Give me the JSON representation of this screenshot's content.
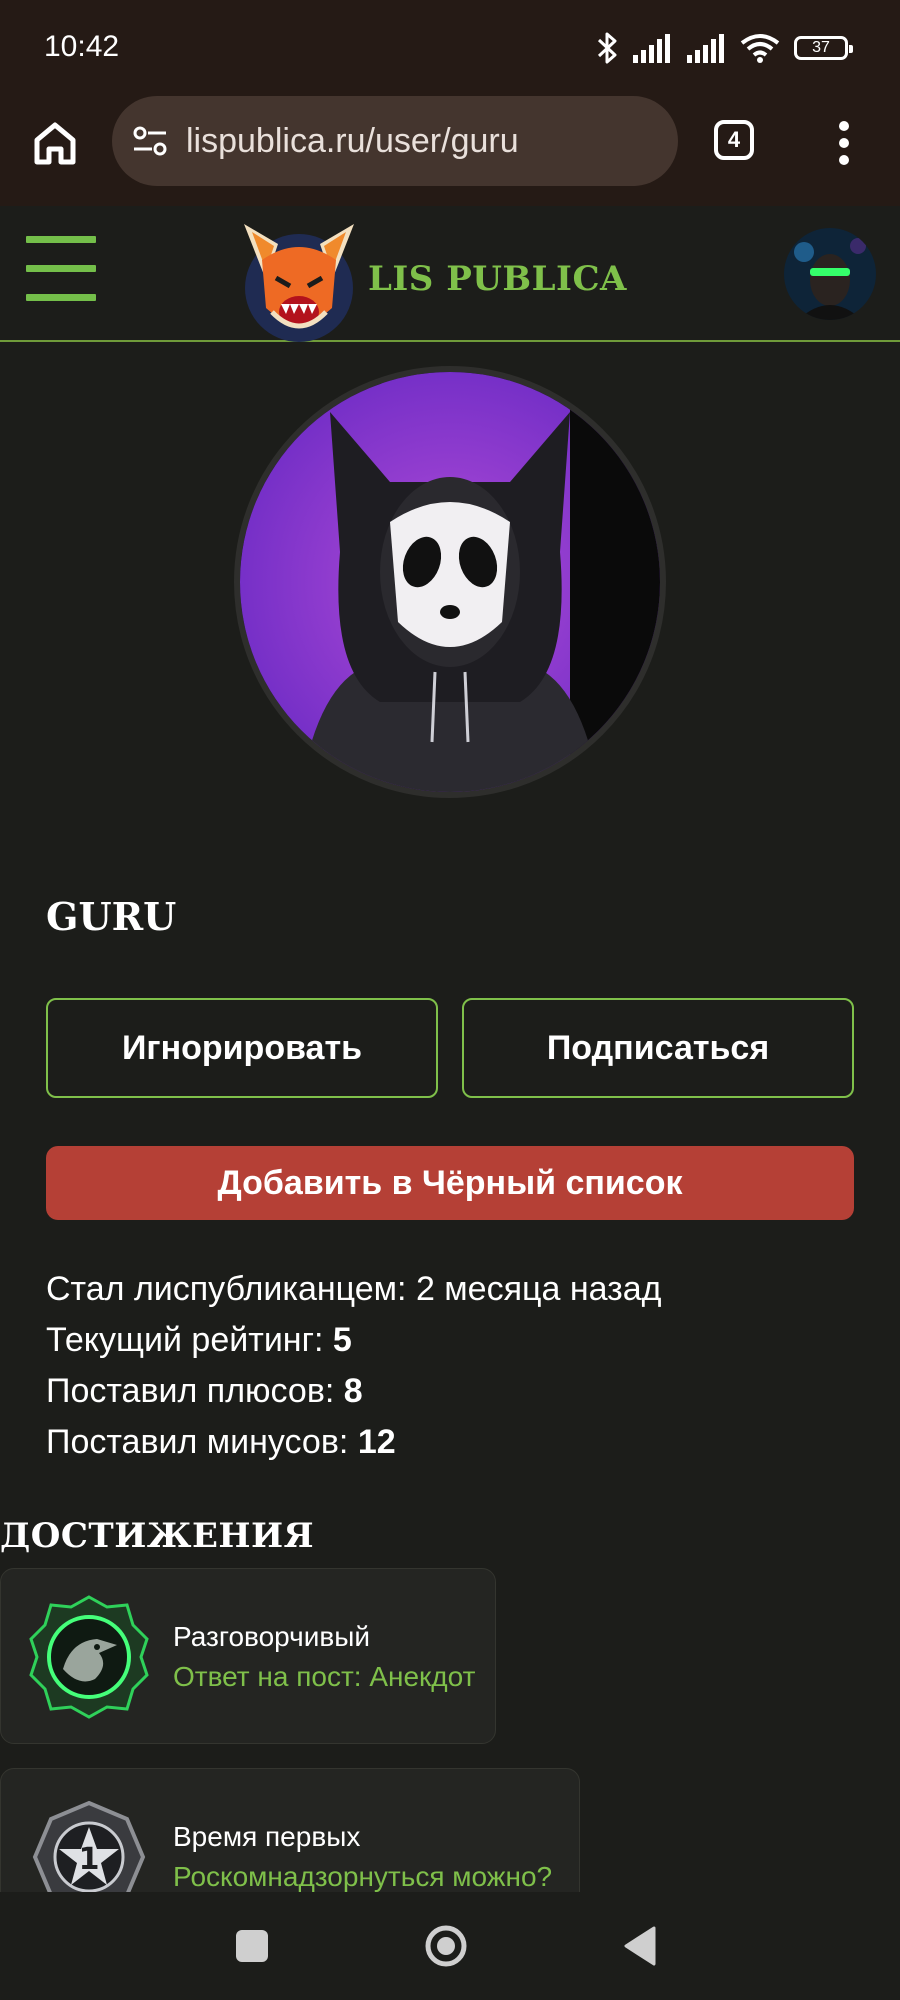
{
  "status_bar": {
    "time": "10:42",
    "battery": "37"
  },
  "browser": {
    "url": "lispublica.ru/user/guru",
    "tab_count": "4"
  },
  "site": {
    "name": "LIS PUBLICA"
  },
  "profile": {
    "username": "GURU",
    "ignore_label": "Игнорировать",
    "subscribe_label": "Подписаться",
    "blacklist_label": "Добавить в Чёрный список"
  },
  "stats": {
    "joined_label": "Стал лиспубликанцем:",
    "joined_value": "2 месяца назад",
    "rating_label": "Текущий рейтинг:",
    "rating_value": "5",
    "pluses_label": "Поставил плюсов:",
    "pluses_value": "8",
    "minuses_label": "Поставил минусов:",
    "minuses_value": "12"
  },
  "achievements": {
    "title": "ДОСТИЖЕНИЯ",
    "items": [
      {
        "name": "Разговорчивый",
        "description": "Ответ на пост: Анекдот",
        "icon": "raven-badge-icon"
      },
      {
        "name": "Время первых",
        "description": "Роскомнадзорнуться можно?",
        "icon": "number-one-badge-icon"
      }
    ]
  },
  "colors": {
    "accent": "#7fc04a",
    "danger": "#b54036",
    "background": "#1c1d1a",
    "chrome": "#251a15"
  }
}
